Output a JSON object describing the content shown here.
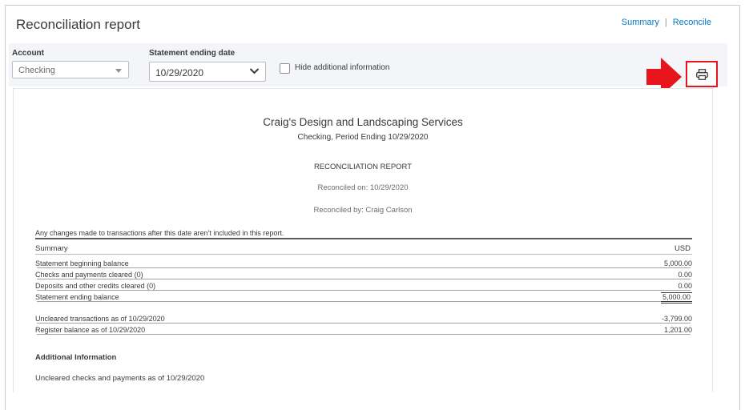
{
  "header": {
    "title": "Reconciliation report",
    "summary_link": "Summary",
    "separator": "|",
    "reconcile_link": "Reconcile"
  },
  "filters": {
    "account_label": "Account",
    "account_value": "Checking",
    "statement_label": "Statement ending date",
    "statement_value": "10/29/2020",
    "hide_label": "Hide additional information",
    "hide_checked": false
  },
  "icons": {
    "print": "printer-icon",
    "annotation": "red-arrow-right"
  },
  "colors": {
    "accent_link": "#0077c5",
    "highlight_red": "#e8141c",
    "filter_bg": "#f4f5f8"
  },
  "report": {
    "company": "Craig's Design and Landscaping Services",
    "subheading": "Checking, Period Ending 10/29/2020",
    "title": "RECONCILIATION REPORT",
    "reconciled_on": "Reconciled on: 10/29/2020",
    "reconciled_by": "Reconciled by: Craig Carlson",
    "note": "Any changes made to transactions after this date aren't included in this report.",
    "summary_label": "Summary",
    "currency": "USD",
    "rows": [
      {
        "label": "Statement beginning balance",
        "amount": "5,000.00"
      },
      {
        "label": "Checks and payments cleared (0)",
        "amount": "0.00"
      },
      {
        "label": "Deposits and other credits cleared (0)",
        "amount": "0.00"
      },
      {
        "label": "Statement ending balance",
        "amount": "5,000.00"
      }
    ],
    "rows2": [
      {
        "label": "Uncleared transactions as of 10/29/2020",
        "amount": "-3,799.00"
      },
      {
        "label": "Register balance as of 10/29/2020",
        "amount": "1,201.00"
      }
    ],
    "additional_label": "Additional Information",
    "uncleared_checks_label": "Uncleared checks and payments as of 10/29/2020"
  }
}
